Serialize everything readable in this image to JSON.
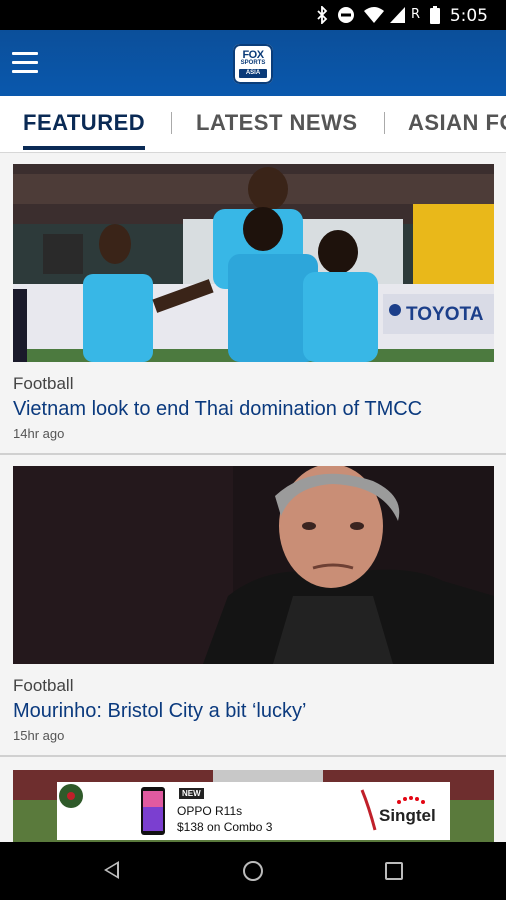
{
  "status_bar": {
    "time": "5:05",
    "carrier_indicator": "R",
    "icons": [
      "bluetooth-icon",
      "do-not-disturb-icon",
      "wifi-icon",
      "signal-icon",
      "battery-icon"
    ]
  },
  "app_bar": {
    "logo_line1": "FOX",
    "logo_line2": "SPORTS",
    "logo_line3": "ASIA"
  },
  "tabs": [
    {
      "label": "FEATURED",
      "active": true
    },
    {
      "label": "LATEST NEWS",
      "active": false
    },
    {
      "label": "ASIAN FO",
      "active": false
    }
  ],
  "articles": [
    {
      "category": "Football",
      "title": "Vietnam look to end Thai domination of TMCC",
      "time": "14hr ago",
      "image_sponsor_text": "TOYOTA"
    },
    {
      "category": "Football",
      "title": "Mourinho: Bristol City a bit ‘lucky’",
      "time": "15hr ago"
    }
  ],
  "ad": {
    "badge": "NEW",
    "product": "OPPO R11s",
    "offer": "$138 on Combo 3",
    "brand": "Singtel"
  },
  "colors": {
    "app_bar": "#0a58ad",
    "tab_active": "#0a2a55",
    "title": "#0b3a7e",
    "brand_red": "#e30613"
  }
}
